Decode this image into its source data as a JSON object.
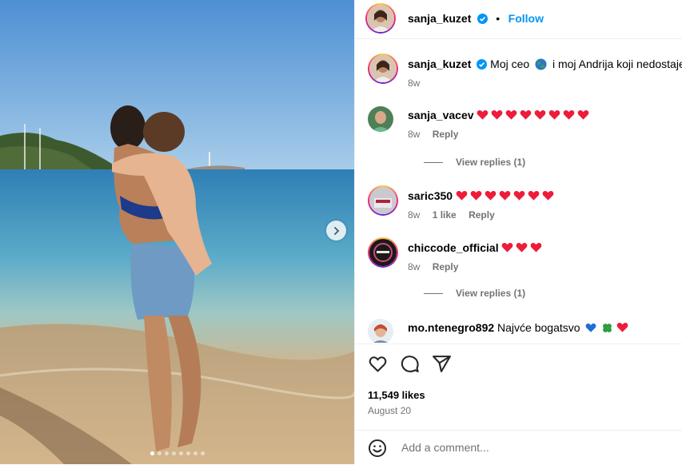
{
  "post": {
    "author": "sanja_kuzet",
    "follow_label": "Follow",
    "separator": "•",
    "caption_text": "Moj ceo",
    "caption_rest": "i moj Andrija koji nedostaje..",
    "caption_time": "8w",
    "likes": "11,549 likes",
    "date": "August 20",
    "add_comment_placeholder": "Add a comment...",
    "carousel": {
      "slides": 8,
      "active_index": 0
    }
  },
  "comments": [
    {
      "user": "sanja_vacev",
      "text": "",
      "hearts": 8,
      "time": "8w",
      "likes": "",
      "reply": "Reply",
      "view_replies": "View replies (1)"
    },
    {
      "user": "saric350",
      "text": "",
      "hearts": 7,
      "time": "8w",
      "likes": "1 like",
      "reply": "Reply",
      "view_replies": ""
    },
    {
      "user": "chiccode_official",
      "text": "",
      "hearts": 3,
      "time": "8w",
      "likes": "",
      "reply": "Reply",
      "view_replies": "View replies (1)"
    },
    {
      "user": "mo.ntenegro892",
      "text": "Najvće bogatsvo",
      "hearts": 1,
      "time": "",
      "likes": "",
      "reply": "",
      "view_replies": ""
    }
  ],
  "icons": {
    "like": "heart-outline-icon",
    "comment": "comment-bubble-icon",
    "share": "paper-plane-icon",
    "emoji": "smiley-icon",
    "next": "chevron-right-icon",
    "verified": "verified-badge-icon"
  },
  "colors": {
    "follow": "#0095f6",
    "verified": "#0095f6",
    "heart": "#ed1c3a",
    "muted": "#737373",
    "border": "#efefef"
  }
}
